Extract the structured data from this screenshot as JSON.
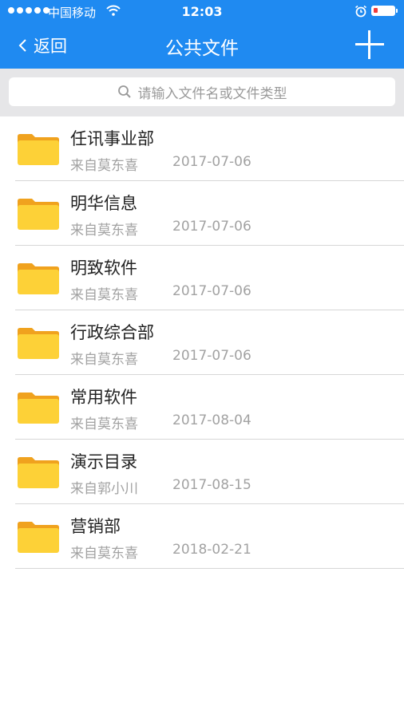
{
  "status": {
    "carrier": "中国移动",
    "time": "12:03",
    "battery_color": "#f23b3b"
  },
  "nav": {
    "back_label": "返回",
    "title": "公共文件",
    "add_icon": "plus-icon",
    "bg_color": "#1f8af1"
  },
  "search": {
    "placeholder": "请输入文件名或文件类型",
    "icon": "search-icon"
  },
  "folders": [
    {
      "name": "任讯事业部",
      "source": "来自莫东喜",
      "date": "2017-07-06"
    },
    {
      "name": "明华信息",
      "source": "来自莫东喜",
      "date": "2017-07-06"
    },
    {
      "name": "明致软件",
      "source": "来自莫东喜",
      "date": "2017-07-06"
    },
    {
      "name": "行政综合部",
      "source": "来自莫东喜",
      "date": "2017-07-06"
    },
    {
      "name": "常用软件",
      "source": "来自莫东喜",
      "date": "2017-08-04"
    },
    {
      "name": "演示目录",
      "source": "来自郭小川",
      "date": "2017-08-15"
    },
    {
      "name": "营销部",
      "source": "来自莫东喜",
      "date": "2018-02-21"
    }
  ]
}
